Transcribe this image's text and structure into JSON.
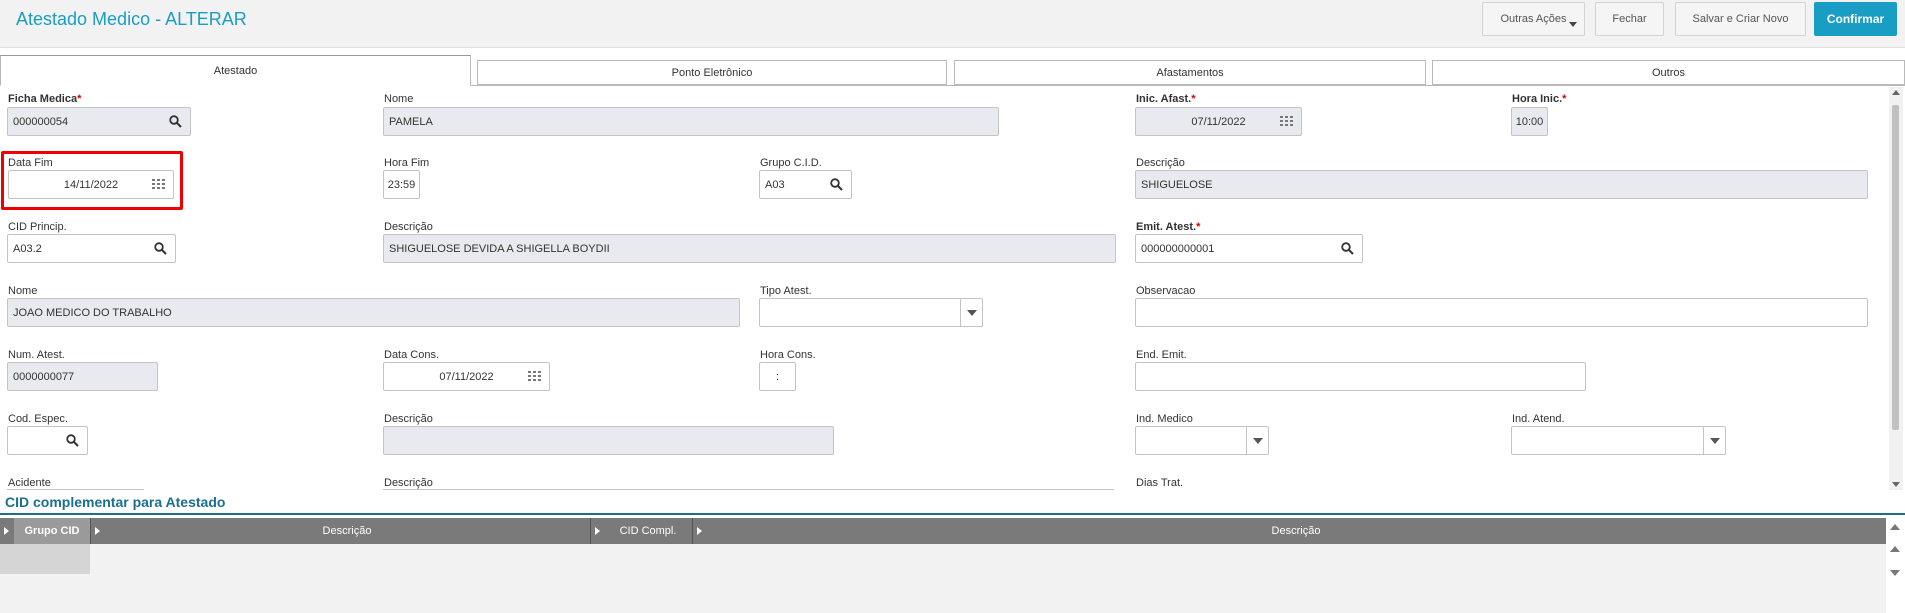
{
  "header": {
    "title": "Atestado Medico - ALTERAR",
    "buttons": {
      "outras_acoes": "Outras Ações",
      "fechar": "Fechar",
      "salvar_novo": "Salvar e Criar Novo",
      "confirmar": "Confirmar"
    }
  },
  "tabs": [
    "Atestado",
    "Ponto Eletrônico",
    "Afastamentos",
    "Outros"
  ],
  "fields": {
    "ficha_medica": {
      "label": "Ficha Medica",
      "value": "000000054"
    },
    "nome": {
      "label": "Nome",
      "value": "PAMELA"
    },
    "inic_afast": {
      "label": "Inic. Afast.",
      "value": "07/11/2022"
    },
    "hora_inic": {
      "label": "Hora Inic.",
      "value": "10:00"
    },
    "data_fim": {
      "label": "Data Fim",
      "value": "14/11/2022"
    },
    "hora_fim": {
      "label": "Hora Fim",
      "value": "23:59"
    },
    "grupo_cid": {
      "label": "Grupo C.I.D.",
      "value": "A03"
    },
    "descricao1": {
      "label": "Descrição",
      "value": "SHIGUELOSE"
    },
    "cid_princ": {
      "label": "CID Princip.",
      "value": "A03.2"
    },
    "descricao2": {
      "label": "Descrição",
      "value": "SHIGUELOSE DEVIDA A SHIGELLA BOYDII"
    },
    "emit_atest": {
      "label": "Emit. Atest.",
      "value": "000000000001"
    },
    "nome_medico": {
      "label": "Nome",
      "value": "JOAO MEDICO DO TRABALHO"
    },
    "tipo_atest": {
      "label": "Tipo Atest.",
      "value": ""
    },
    "observacao": {
      "label": "Observacao",
      "value": ""
    },
    "num_atest": {
      "label": "Num. Atest.",
      "value": "0000000077"
    },
    "data_cons": {
      "label": "Data Cons.",
      "value": "07/11/2022"
    },
    "hora_cons": {
      "label": "Hora Cons.",
      "value": ":"
    },
    "end_emit": {
      "label": "End. Emit.",
      "value": ""
    },
    "cod_espec": {
      "label": "Cod. Espec.",
      "value": ""
    },
    "descricao3": {
      "label": "Descrição",
      "value": ""
    },
    "ind_medico": {
      "label": "Ind. Medico",
      "value": ""
    },
    "ind_atend": {
      "label": "Ind. Atend.",
      "value": ""
    },
    "acidente": {
      "label": "Acidente"
    },
    "descricao4": {
      "label": "Descrição"
    },
    "dias_trat": {
      "label": "Dias Trat."
    }
  },
  "section": {
    "title": "CID complementar para Atestado"
  },
  "grid": {
    "columns": [
      "Grupo CID",
      "Descrição",
      "CID Compl.",
      "Descrição"
    ]
  },
  "colors": {
    "accent": "#1a9dc4",
    "highlight": "#e00000",
    "required": "#dd0000"
  }
}
